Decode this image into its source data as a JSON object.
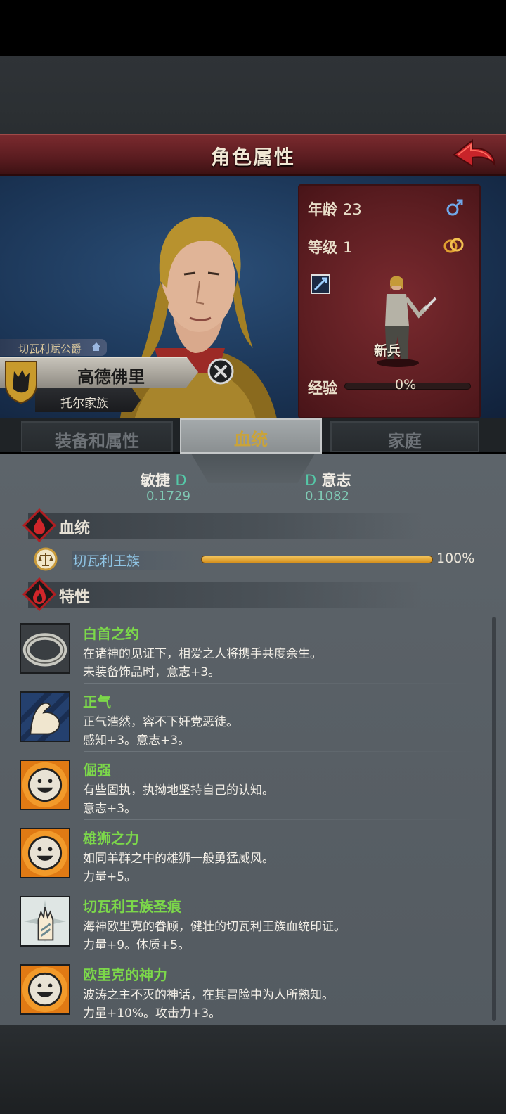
{
  "header": {
    "title": "角色属性"
  },
  "character": {
    "title_tag": "切瓦利赋公爵",
    "name": "高德佛里",
    "family": "托尔家族"
  },
  "stats": {
    "age_label": "年龄",
    "age_value": "23",
    "level_label": "等级",
    "level_value": "1",
    "class_name": "新兵",
    "exp_label": "经验",
    "exp_value": "0%",
    "exp_progress": 0
  },
  "tabs": [
    {
      "label": "装备和属性"
    },
    {
      "label": "血统"
    },
    {
      "label": "家庭"
    }
  ],
  "attributes": [
    {
      "name": "敏捷",
      "grade": "D",
      "value": "0.1729"
    },
    {
      "name": "意志",
      "grade": "D",
      "value": "0.1082"
    }
  ],
  "bloodline_section": {
    "title": "血统",
    "entries": [
      {
        "name": "切瓦利王族",
        "percent": "100%",
        "progress": 1.0
      }
    ]
  },
  "traits_section": {
    "title": "特性",
    "traits": [
      {
        "name": "白首之约",
        "desc": "在诸神的见证下，相爱之人将携手共度余生。",
        "effect": "未装备饰品时，意志+3。",
        "icon": "ring-icon"
      },
      {
        "name": "正气",
        "desc": "正气浩然，容不下奸党恶徒。",
        "effect": "感知+3。意志+3。",
        "icon": "flexed-arm-icon"
      },
      {
        "name": "倔强",
        "desc": "有些固执，执拗地坚持自己的认知。",
        "effect": "意志+3。",
        "icon": "smiley-icon"
      },
      {
        "name": "雄狮之力",
        "desc": "如同羊群之中的雄狮一般勇猛威风。",
        "effect": "力量+5。",
        "icon": "smiley-icon"
      },
      {
        "name": "切瓦利王族圣痕",
        "desc": "海神欧里克的眷顾，健壮的切瓦利王族血统印证。",
        "effect": "力量+9。体质+5。",
        "icon": "sacred-hand-icon"
      },
      {
        "name": "欧里克的神力",
        "desc": "波涛之主不灭的神话，在其冒险中为人所熟知。",
        "effect": "力量+10%。攻击力+3。",
        "icon": "smiley-icon"
      }
    ]
  },
  "colors": {
    "header_red": "#5a1c20",
    "trait_name_green": "#7cd84a",
    "grade_teal": "#55c7a7",
    "bloodline_blue": "#8fc4e4",
    "active_tab_gold": "#c9a33a"
  }
}
